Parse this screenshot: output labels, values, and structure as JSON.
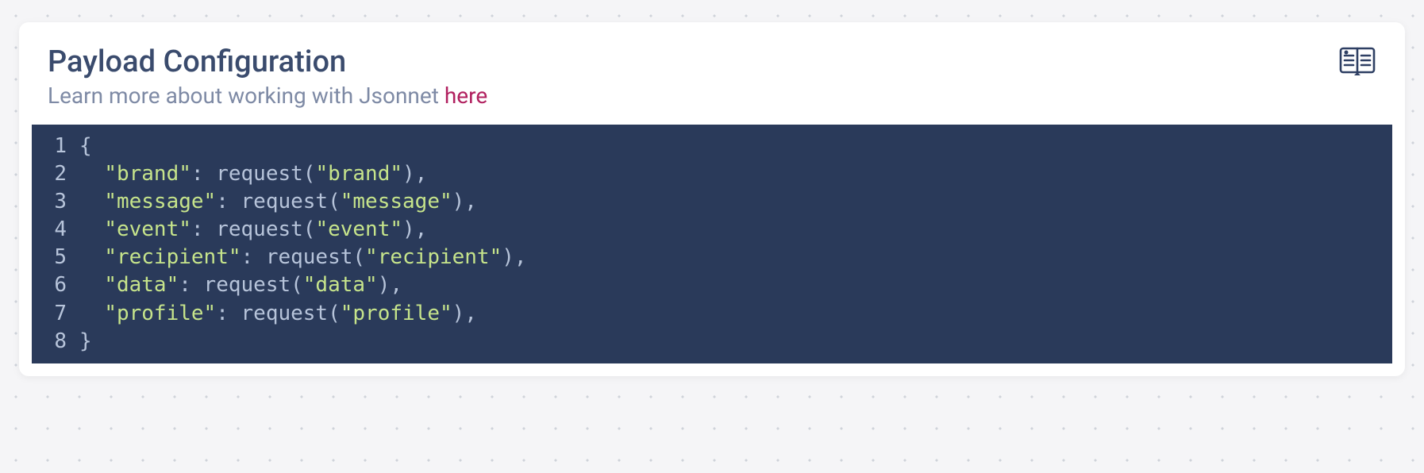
{
  "card": {
    "title": "Payload Configuration",
    "subtitle_prefix": "Learn more about working with Jsonnet ",
    "subtitle_link": "here"
  },
  "editor": {
    "lines": [
      {
        "n": "1",
        "tokens": [
          {
            "t": "punct",
            "v": "{"
          }
        ]
      },
      {
        "n": "2",
        "tokens": [
          {
            "t": "punct",
            "v": "  "
          },
          {
            "t": "str",
            "v": "\"brand\""
          },
          {
            "t": "punct",
            "v": ": "
          },
          {
            "t": "fn",
            "v": "request"
          },
          {
            "t": "punct",
            "v": "("
          },
          {
            "t": "str",
            "v": "\"brand\""
          },
          {
            "t": "punct",
            "v": "),"
          }
        ]
      },
      {
        "n": "3",
        "tokens": [
          {
            "t": "punct",
            "v": "  "
          },
          {
            "t": "str",
            "v": "\"message\""
          },
          {
            "t": "punct",
            "v": ": "
          },
          {
            "t": "fn",
            "v": "request"
          },
          {
            "t": "punct",
            "v": "("
          },
          {
            "t": "str",
            "v": "\"message\""
          },
          {
            "t": "punct",
            "v": "),"
          }
        ]
      },
      {
        "n": "4",
        "tokens": [
          {
            "t": "punct",
            "v": "  "
          },
          {
            "t": "str",
            "v": "\"event\""
          },
          {
            "t": "punct",
            "v": ": "
          },
          {
            "t": "fn",
            "v": "request"
          },
          {
            "t": "punct",
            "v": "("
          },
          {
            "t": "str",
            "v": "\"event\""
          },
          {
            "t": "punct",
            "v": "),"
          }
        ]
      },
      {
        "n": "5",
        "tokens": [
          {
            "t": "punct",
            "v": "  "
          },
          {
            "t": "str",
            "v": "\"recipient\""
          },
          {
            "t": "punct",
            "v": ": "
          },
          {
            "t": "fn",
            "v": "request"
          },
          {
            "t": "punct",
            "v": "("
          },
          {
            "t": "str",
            "v": "\"recipient\""
          },
          {
            "t": "punct",
            "v": "),"
          }
        ]
      },
      {
        "n": "6",
        "tokens": [
          {
            "t": "punct",
            "v": "  "
          },
          {
            "t": "str",
            "v": "\"data\""
          },
          {
            "t": "punct",
            "v": ": "
          },
          {
            "t": "fn",
            "v": "request"
          },
          {
            "t": "punct",
            "v": "("
          },
          {
            "t": "str",
            "v": "\"data\""
          },
          {
            "t": "punct",
            "v": "),"
          }
        ]
      },
      {
        "n": "7",
        "tokens": [
          {
            "t": "punct",
            "v": "  "
          },
          {
            "t": "str",
            "v": "\"profile\""
          },
          {
            "t": "punct",
            "v": ": "
          },
          {
            "t": "fn",
            "v": "request"
          },
          {
            "t": "punct",
            "v": "("
          },
          {
            "t": "str",
            "v": "\"profile\""
          },
          {
            "t": "punct",
            "v": "),"
          }
        ]
      },
      {
        "n": "8",
        "tokens": [
          {
            "t": "punct",
            "v": "}"
          }
        ]
      }
    ]
  }
}
